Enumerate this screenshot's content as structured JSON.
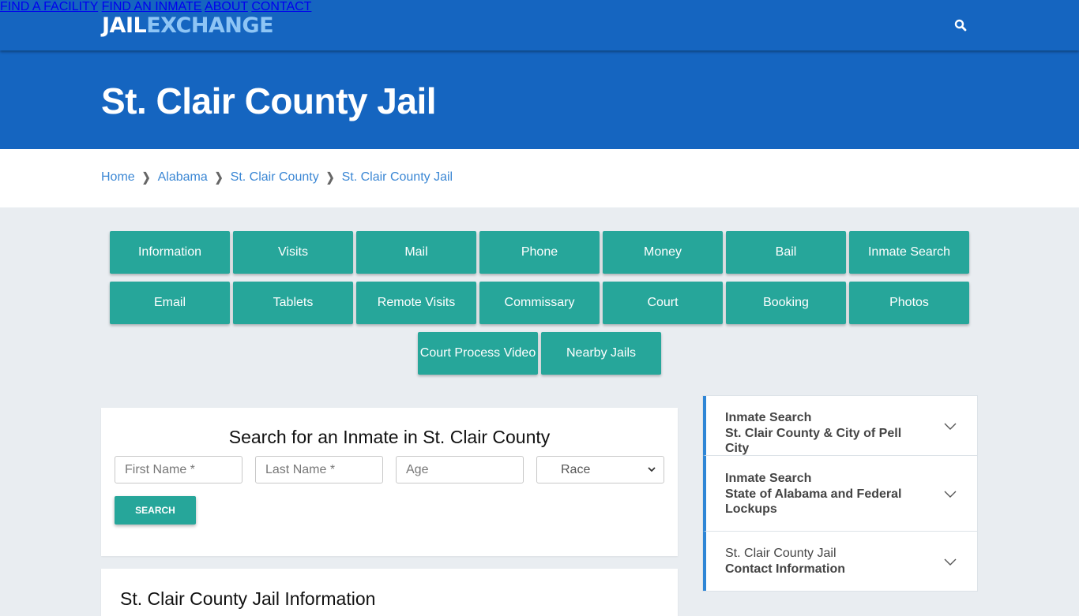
{
  "header": {
    "logo": {
      "part1": "JAIL",
      "part2": "EXCHANGE"
    },
    "nav": [
      {
        "label": "FIND A FACILITY"
      },
      {
        "label": "FIND AN INMATE"
      },
      {
        "label": "ABOUT"
      },
      {
        "label": "CONTACT"
      }
    ],
    "search_icon": "search-icon"
  },
  "hero": {
    "title": "St. Clair County Jail"
  },
  "breadcrumb": [
    {
      "label": "Home"
    },
    {
      "label": "Alabama"
    },
    {
      "label": "St. Clair County"
    },
    {
      "label": "St. Clair County Jail"
    }
  ],
  "topic_buttons": [
    {
      "label": "Information"
    },
    {
      "label": "Visits"
    },
    {
      "label": "Mail"
    },
    {
      "label": "Phone"
    },
    {
      "label": "Money"
    },
    {
      "label": "Bail"
    },
    {
      "label": "Inmate Search"
    },
    {
      "label": "Email"
    },
    {
      "label": "Tablets"
    },
    {
      "label": "Remote Visits"
    },
    {
      "label": "Commissary"
    },
    {
      "label": "Court"
    },
    {
      "label": "Booking"
    },
    {
      "label": "Photos"
    },
    {
      "label": "Court Process Video"
    },
    {
      "label": "Nearby Jails"
    }
  ],
  "search_form": {
    "title": "Search for an Inmate in St. Clair County",
    "first_name": {
      "placeholder": "First Name *",
      "value": ""
    },
    "last_name": {
      "placeholder": "Last Name *",
      "value": ""
    },
    "age": {
      "placeholder": "Age",
      "value": ""
    },
    "race": {
      "selected": "Race"
    },
    "submit_label": "SEARCH"
  },
  "info_section": {
    "title": "St. Clair County Jail Information"
  },
  "sidebar": {
    "items": [
      {
        "line1": "Inmate Search",
        "line2": "St. Clair County & City of Pell City"
      },
      {
        "line1": "Inmate Search",
        "line2": "State of Alabama and Federal Lockups"
      },
      {
        "line1": "St. Clair County Jail",
        "line2": "Contact Information"
      }
    ]
  },
  "colors": {
    "brand_blue": "#1565c0",
    "logo_accent": "#8ec5f5",
    "button_teal": "#26a69a",
    "link_blue": "#3b87d4",
    "sidebar_accent": "#2f86d6",
    "page_bg": "#e9edf1"
  }
}
